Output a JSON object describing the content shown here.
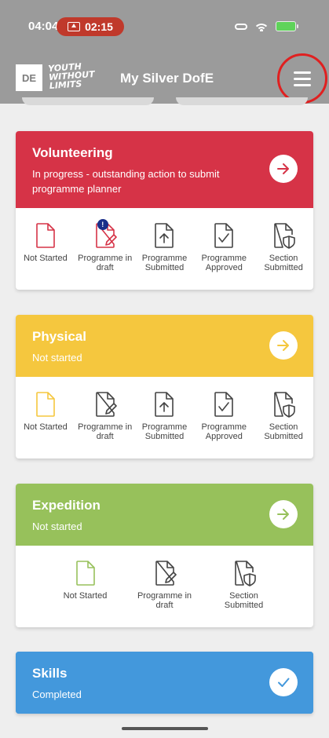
{
  "status_bar": {
    "time": "04:04",
    "recording": "02:15"
  },
  "header": {
    "logo_short": "DE",
    "logo_slogan": "YOUTH WITHOUT LIMITS",
    "title": "My Silver DofE"
  },
  "colors": {
    "volunteering": "#d63347",
    "physical": "#f5c73e",
    "expedition": "#97c15b",
    "skills": "#4398dc",
    "header": "#9b9b9b"
  },
  "sections": [
    {
      "title": "Volunteering",
      "status": "In progress - outstanding action to submit programme planner",
      "action_icon": "arrow-right-icon",
      "steps": [
        {
          "label": "Not Started",
          "icon": "document-icon"
        },
        {
          "label": "Programme in draft",
          "icon": "document-edit-icon",
          "alert": "!"
        },
        {
          "label": "Programme Submitted",
          "icon": "document-upload-icon"
        },
        {
          "label": "Programme Approved",
          "icon": "document-check-icon"
        },
        {
          "label": "Section Submitted",
          "icon": "document-shield-icon"
        }
      ]
    },
    {
      "title": "Physical",
      "status": "Not started",
      "action_icon": "arrow-right-icon",
      "steps": [
        {
          "label": "Not Started",
          "icon": "document-icon"
        },
        {
          "label": "Programme in draft",
          "icon": "document-edit-icon"
        },
        {
          "label": "Programme Submitted",
          "icon": "document-upload-icon"
        },
        {
          "label": "Programme Approved",
          "icon": "document-check-icon"
        },
        {
          "label": "Section Submitted",
          "icon": "document-shield-icon"
        }
      ]
    },
    {
      "title": "Expedition",
      "status": "Not started",
      "action_icon": "arrow-right-icon",
      "steps": [
        {
          "label": "Not Started",
          "icon": "document-icon"
        },
        {
          "label": "Programme in draft",
          "icon": "document-edit-icon"
        },
        {
          "label": "Section Submitted",
          "icon": "document-shield-icon"
        }
      ]
    },
    {
      "title": "Skills",
      "status": "Completed",
      "action_icon": "checkmark-icon"
    }
  ]
}
